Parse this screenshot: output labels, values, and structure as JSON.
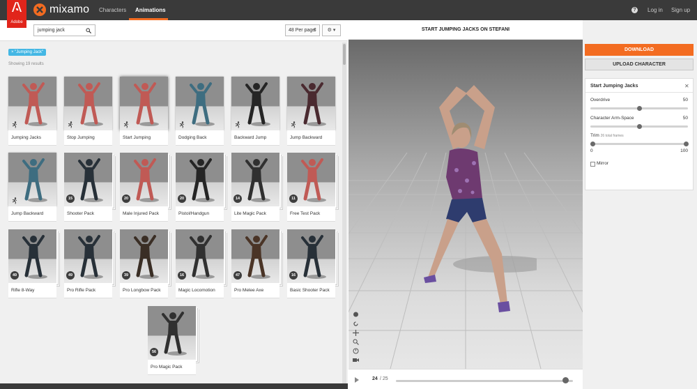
{
  "adobe": {
    "label": "Adobe"
  },
  "app": {
    "name": "mixamo"
  },
  "nav": {
    "characters": "Characters",
    "animations": "Animations",
    "login": "Log in",
    "signup": "Sign up",
    "help": "?"
  },
  "search": {
    "value": "jumping jack",
    "icon": "search-icon"
  },
  "per_page": {
    "value": "48 Per page",
    "arrow": "⇕"
  },
  "settings": {
    "label": "⚙ ▾"
  },
  "filter": {
    "tag": "× \"Jumping Jack\"",
    "results": "Showing 19 results"
  },
  "cards": [
    {
      "label": "Jumping Jacks",
      "badge": "",
      "color": "#c05a55"
    },
    {
      "label": "Stop Jumping",
      "badge": "",
      "color": "#c05a55"
    },
    {
      "label": "Start Jumping",
      "badge": "",
      "color": "#c05a55"
    },
    {
      "label": "Dodging Back",
      "badge": "",
      "color": "#3e6d80"
    },
    {
      "label": "Backward Jump",
      "badge": "",
      "color": "#252525"
    },
    {
      "label": "Jump Backward",
      "badge": "",
      "color": "#4a2a30"
    },
    {
      "label": "Jump Backward",
      "badge": "",
      "color": "#3e6d80"
    },
    {
      "label": "Shooter Pack",
      "badge": "15",
      "color": "#273038"
    },
    {
      "label": "Male Injured Pack",
      "badge": "20",
      "color": "#c05a55"
    },
    {
      "label": "Pistol/Handgun",
      "badge": "20",
      "color": "#252525"
    },
    {
      "label": "Lite Magic Pack",
      "badge": "14",
      "color": "#303030"
    },
    {
      "label": "Free Test Pack",
      "badge": "11",
      "color": "#c05a55"
    },
    {
      "label": "Rifle 8-Way",
      "badge": "49",
      "color": "#273038"
    },
    {
      "label": "Pro Rifle Pack",
      "badge": "49",
      "color": "#273038"
    },
    {
      "label": "Pro Longbow Pack",
      "badge": "39",
      "color": "#3a2e25"
    },
    {
      "label": "Magic Locomotion",
      "badge": "16",
      "color": "#303030"
    },
    {
      "label": "Pro Melee Axe",
      "badge": "47",
      "color": "#4a3426"
    },
    {
      "label": "Basic Shooter Pack",
      "badge": "16",
      "color": "#273038"
    },
    {
      "label": "Pro Magic Pack",
      "badge": "56",
      "color": "#303030"
    }
  ],
  "viewer": {
    "title": "START JUMPING JACKS ON STEFANI"
  },
  "player": {
    "current_frame": "24",
    "total_frames": "/ 25",
    "progress": 0.96
  },
  "right": {
    "download": "DOWNLOAD",
    "upload": "UPLOAD CHARACTER"
  },
  "params": {
    "title": "Start Jumping Jacks",
    "close": "✕",
    "overdrive_label": "Overdrive",
    "overdrive_value": "50",
    "armspace_label": "Character Arm-Space",
    "armspace_value": "50",
    "trim_label": "Trim",
    "trim_sub": "26 total frames",
    "trim_min": "0",
    "trim_max": "100",
    "mirror_label": "Mirror"
  },
  "colors": {
    "accent": "#f36c21",
    "topbar": "#3a3a3a",
    "adobe_red": "#e1251b",
    "tag_blue": "#44b7e4"
  }
}
